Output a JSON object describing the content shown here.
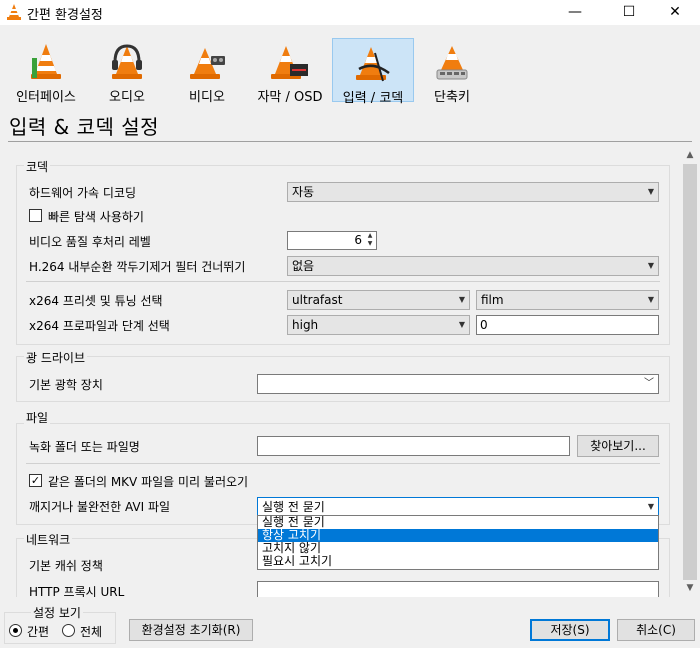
{
  "window": {
    "title": "간편 환경설정",
    "minimize_glyph": "—",
    "maximize_glyph": "☐",
    "close_glyph": "✕"
  },
  "categories": [
    {
      "label": "인터페이스",
      "icon": "interface-cone-icon"
    },
    {
      "label": "오디오",
      "icon": "audio-cone-icon"
    },
    {
      "label": "비디오",
      "icon": "video-cone-icon"
    },
    {
      "label": "자막 / OSD",
      "icon": "subtitles-cone-icon"
    },
    {
      "label": "입력 / 코덱",
      "icon": "input-codec-cone-icon",
      "selected": true
    },
    {
      "label": "단축키",
      "icon": "hotkeys-cone-icon"
    }
  ],
  "page_title": "입력 & 코덱 설정",
  "codec": {
    "title": "코덱",
    "hw_decoding": {
      "label": "하드웨어 가속 디코딩",
      "value": "자동"
    },
    "fast_seek": {
      "label": "빠른 탐색 사용하기",
      "checked": false
    },
    "pp_quality": {
      "label": "비디오 품질 후처리 레벨",
      "value": "6"
    },
    "h264_skip": {
      "label": "H.264 내부순환 깍두기제거 필터 건너뛰기",
      "value": "없음"
    },
    "x264_preset": {
      "label": "x264 프리셋 및 튜닝 선택",
      "preset": "ultrafast",
      "tune": "film"
    },
    "x264_profile": {
      "label": "x264 프로파일과 단계 선택",
      "profile": "high",
      "level": "0"
    }
  },
  "optical": {
    "title": "광 드라이브",
    "device": {
      "label": "기본 광학 장치",
      "value": ""
    }
  },
  "files": {
    "title": "파일",
    "record": {
      "label": "녹화 폴더 또는 파일명",
      "value": "",
      "browse": "찾아보기..."
    },
    "mkv_preload": {
      "label": "같은 폴더의 MKV 파일을 미리 불러오기",
      "checked": true
    },
    "avi_repair": {
      "label": "깨지거나 불완전한 AVI 파일",
      "value": "실행 전 묻기",
      "options": [
        "실행 전 묻기",
        "항상 고치기",
        "고치지 않기",
        "필요시 고치기"
      ],
      "highlighted": 1
    }
  },
  "network": {
    "title": "네트워크",
    "caching": {
      "label": "기본 캐쉬 정책"
    },
    "proxy": {
      "label": "HTTP 프록시 URL",
      "value": ""
    }
  },
  "bottom": {
    "show_settings": "설정 보기",
    "simple": "간편",
    "all": "전체",
    "reset": "환경설정 초기화(R)",
    "save": "저장(S)",
    "cancel": "취소(C)"
  },
  "colors": {
    "accent": "#0078d7",
    "selected_tab_bg": "#cce4f7",
    "vlc_orange": "#f07d0f"
  }
}
